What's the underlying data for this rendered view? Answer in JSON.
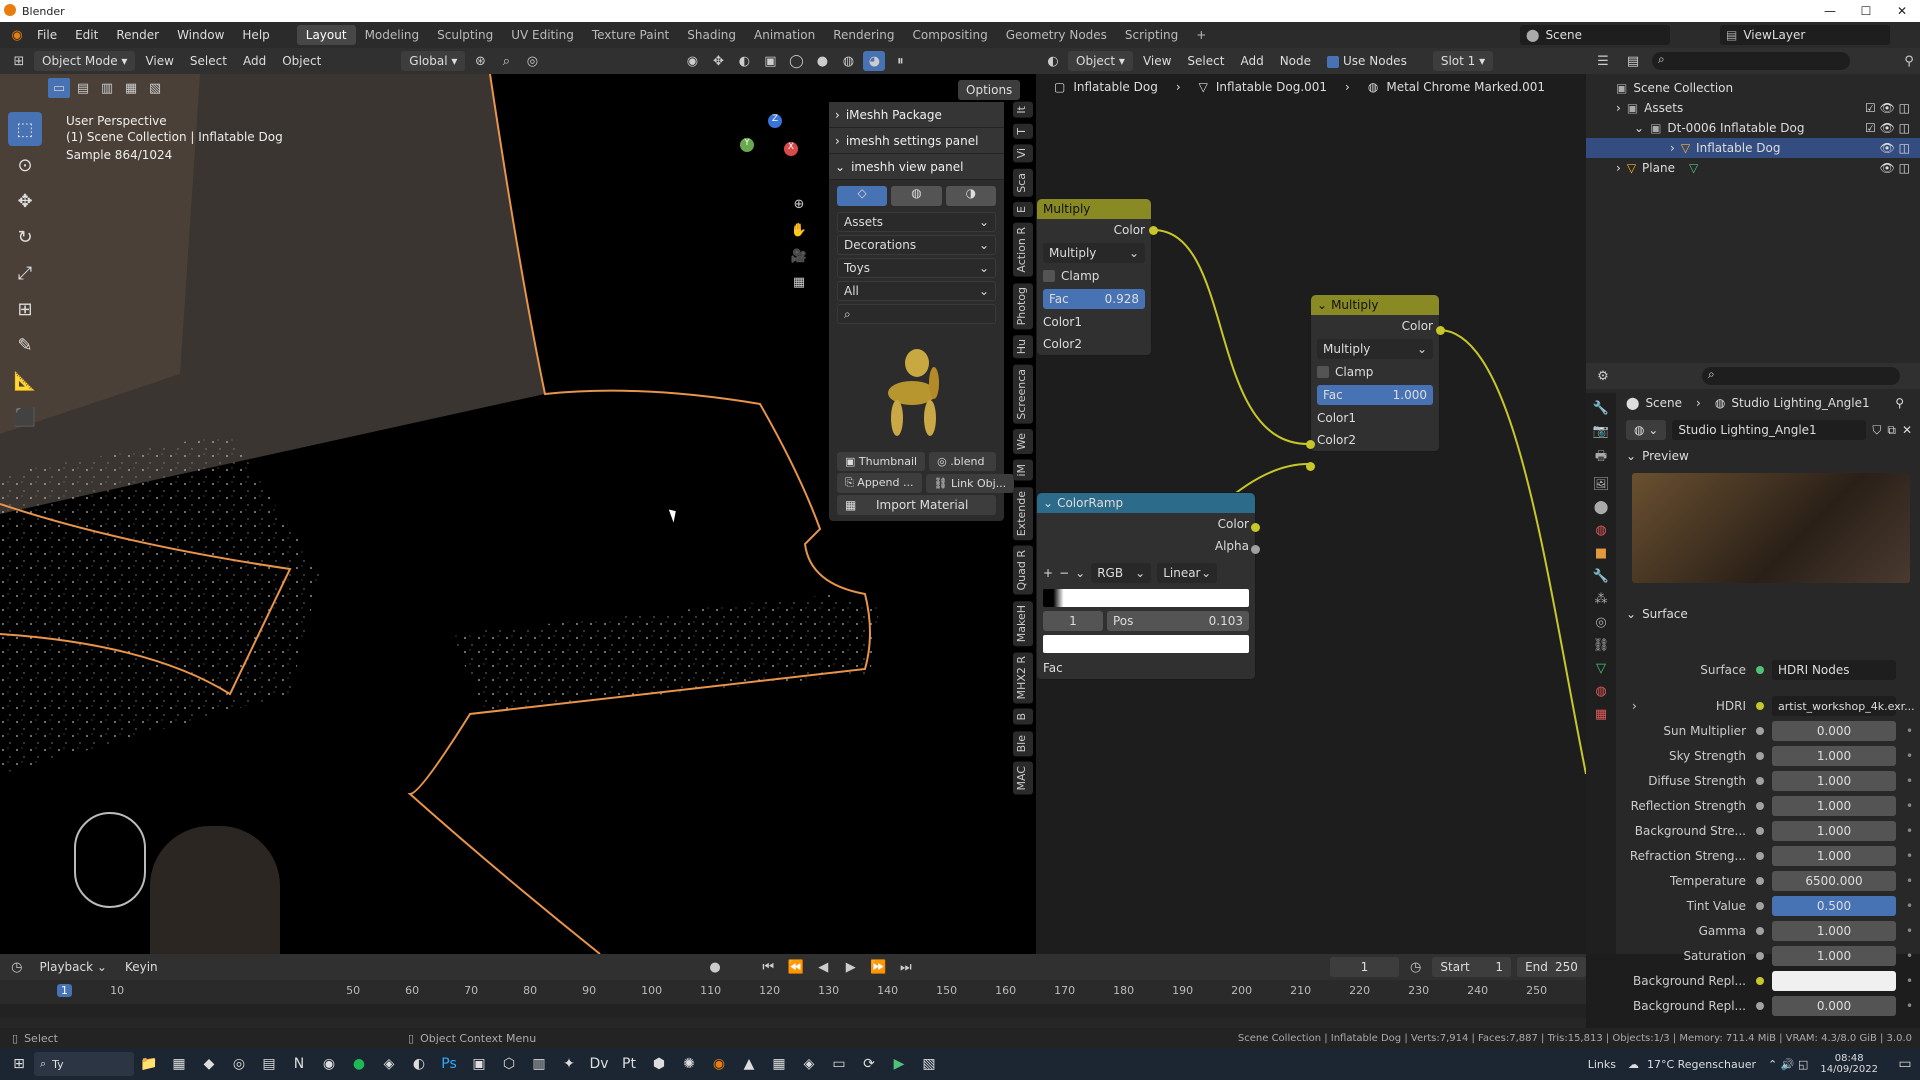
{
  "window": {
    "title": "Blender",
    "min": "—",
    "max": "☐",
    "close": "✕"
  },
  "menubar": {
    "menus": [
      "File",
      "Edit",
      "Render",
      "Window",
      "Help"
    ],
    "workspaces": [
      "Layout",
      "Modeling",
      "Sculpting",
      "UV Editing",
      "Texture Paint",
      "Shading",
      "Animation",
      "Rendering",
      "Compositing",
      "Geometry Nodes",
      "Scripting"
    ],
    "add_tab": "+",
    "scene": "Scene",
    "view_layer": "ViewLayer"
  },
  "viewport_header": {
    "mode": "Object Mode",
    "menus": [
      "View",
      "Select",
      "Add",
      "Object"
    ],
    "orientation": "Global",
    "options": "Options"
  },
  "viewport": {
    "perspective": "User Perspective",
    "collection": "(1) Scene Collection | Inflatable Dog",
    "sample": "Sample 864/1024",
    "axes": {
      "x": "X",
      "y": "Y",
      "z": "Z"
    }
  },
  "imeshh": {
    "package": "iMeshh Package",
    "settings": "imeshh settings panel",
    "view": "imeshh view panel",
    "dropdowns": [
      "Assets",
      "Decorations",
      "Toys",
      "All"
    ],
    "thumbnail": "Thumbnail",
    "blend": ".blend",
    "append": "Append ...",
    "link": "Link Obj...",
    "import": "Import Material"
  },
  "side_tabs": [
    "It",
    "T",
    "Vi",
    "Sca",
    "E",
    "Action R",
    "Photog",
    "Hu",
    "Screenca",
    "We",
    "iM",
    "Extende",
    "Quad R",
    "MakeH",
    "MHX2 R",
    "B",
    "Ble",
    "MAC"
  ],
  "node_header": {
    "object": "Object",
    "menus": [
      "View",
      "Select",
      "Add",
      "Node"
    ],
    "use_nodes": "Use Nodes",
    "slot": "Slot 1",
    "breadcrumb": [
      "Inflatable Dog",
      "Inflatable Dog.001",
      "Metal Chrome Marked.001"
    ]
  },
  "nodes": {
    "multiply1": {
      "title": "Multiply",
      "out": "Color",
      "blend": "Multiply",
      "clamp": "Clamp",
      "fac_label": "Fac",
      "fac": "0.928",
      "c1": "Color1",
      "c2": "Color2"
    },
    "multiply2": {
      "title": "Multiply",
      "out": "Color",
      "blend": "Multiply",
      "clamp": "Clamp",
      "fac_label": "Fac",
      "fac": "1.000",
      "c1": "Color1",
      "c2": "Color2"
    },
    "colorramp": {
      "title": "ColorRamp",
      "out_color": "Color",
      "out_alpha": "Alpha",
      "plus": "+",
      "minus": "−",
      "mode": "RGB",
      "interp": "Linear",
      "index": "1",
      "pos_label": "Pos",
      "pos": "0.103",
      "fac": "Fac"
    }
  },
  "outliner": {
    "root": "Scene Collection",
    "items": [
      {
        "label": "Assets",
        "color": "#bbbbbb"
      },
      {
        "label": "Dt-0006 Inflatable Dog",
        "color": "#bbbbbb"
      },
      {
        "label": "Inflatable Dog",
        "color": "#ffaf29"
      },
      {
        "label": "Plane",
        "color": "#ffaf29"
      }
    ]
  },
  "properties": {
    "breadcrumb": [
      "Scene",
      "Studio Lighting_Angle1"
    ],
    "world": "Studio Lighting_Angle1",
    "preview": "Preview",
    "surface_panel": "Surface",
    "surface_label": "Surface",
    "surface_value": "HDRI Nodes",
    "hdri_label": "HDRI",
    "hdri_value": "artist_workshop_4k.exr...",
    "rows": [
      {
        "label": "Sun Multiplier",
        "value": "0.000"
      },
      {
        "label": "Sky Strength",
        "value": "1.000"
      },
      {
        "label": "Diffuse Strength",
        "value": "1.000"
      },
      {
        "label": "Reflection Strength",
        "value": "1.000"
      },
      {
        "label": "Background Stre...",
        "value": "1.000"
      },
      {
        "label": "Refraction Streng...",
        "value": "1.000"
      },
      {
        "label": "Temperature",
        "value": "6500.000"
      },
      {
        "label": "Tint Value",
        "value": "0.500"
      },
      {
        "label": "Gamma",
        "value": "1.000"
      },
      {
        "label": "Saturation",
        "value": "1.000"
      },
      {
        "label": "Background Repl...",
        "value": ""
      },
      {
        "label": "Background Repl...",
        "value": "0.000"
      }
    ]
  },
  "timeline": {
    "playback": "Playback",
    "keying": "Keyin",
    "current_frame": "1",
    "start_label": "Start",
    "start": "1",
    "end_label": "End",
    "end": "250",
    "ticks": [
      "1",
      "10",
      "50",
      "60",
      "70",
      "80",
      "90",
      "100",
      "110",
      "120",
      "130",
      "140",
      "150",
      "160",
      "170",
      "180",
      "190",
      "200",
      "210",
      "220",
      "230",
      "240",
      "250"
    ]
  },
  "statusbar": {
    "select": "Select",
    "context": "Object Context Menu",
    "stats": "Scene Collection | Inflatable Dog | Verts:7,914 | Faces:7,887 | Tris:15,813 | Objects:1/3 | Memory: 711.4 MiB | VRAM: 4.3/8.0 GiB | 3.0.0"
  },
  "taskbar": {
    "search": "Ty",
    "links": "Links",
    "weather": "17°C Regenschauer",
    "time": "08:48",
    "date": "14/09/2022"
  }
}
